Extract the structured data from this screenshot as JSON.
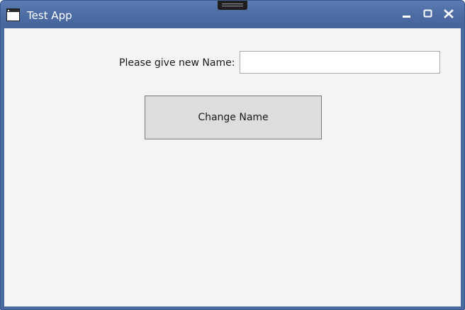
{
  "window": {
    "title": "Test App",
    "icon": "app-window-icon",
    "controls": {
      "minimize": "minimize-icon",
      "maximize": "maximize-icon",
      "close": "close-icon"
    }
  },
  "form": {
    "name_label": "Please give new Name:",
    "name_value": "",
    "name_placeholder": "",
    "change_button_label": "Change Name"
  },
  "colors": {
    "titlebar": "#4a6aa0",
    "client_background": "#f4f4f4",
    "button_background": "#dddddd"
  }
}
